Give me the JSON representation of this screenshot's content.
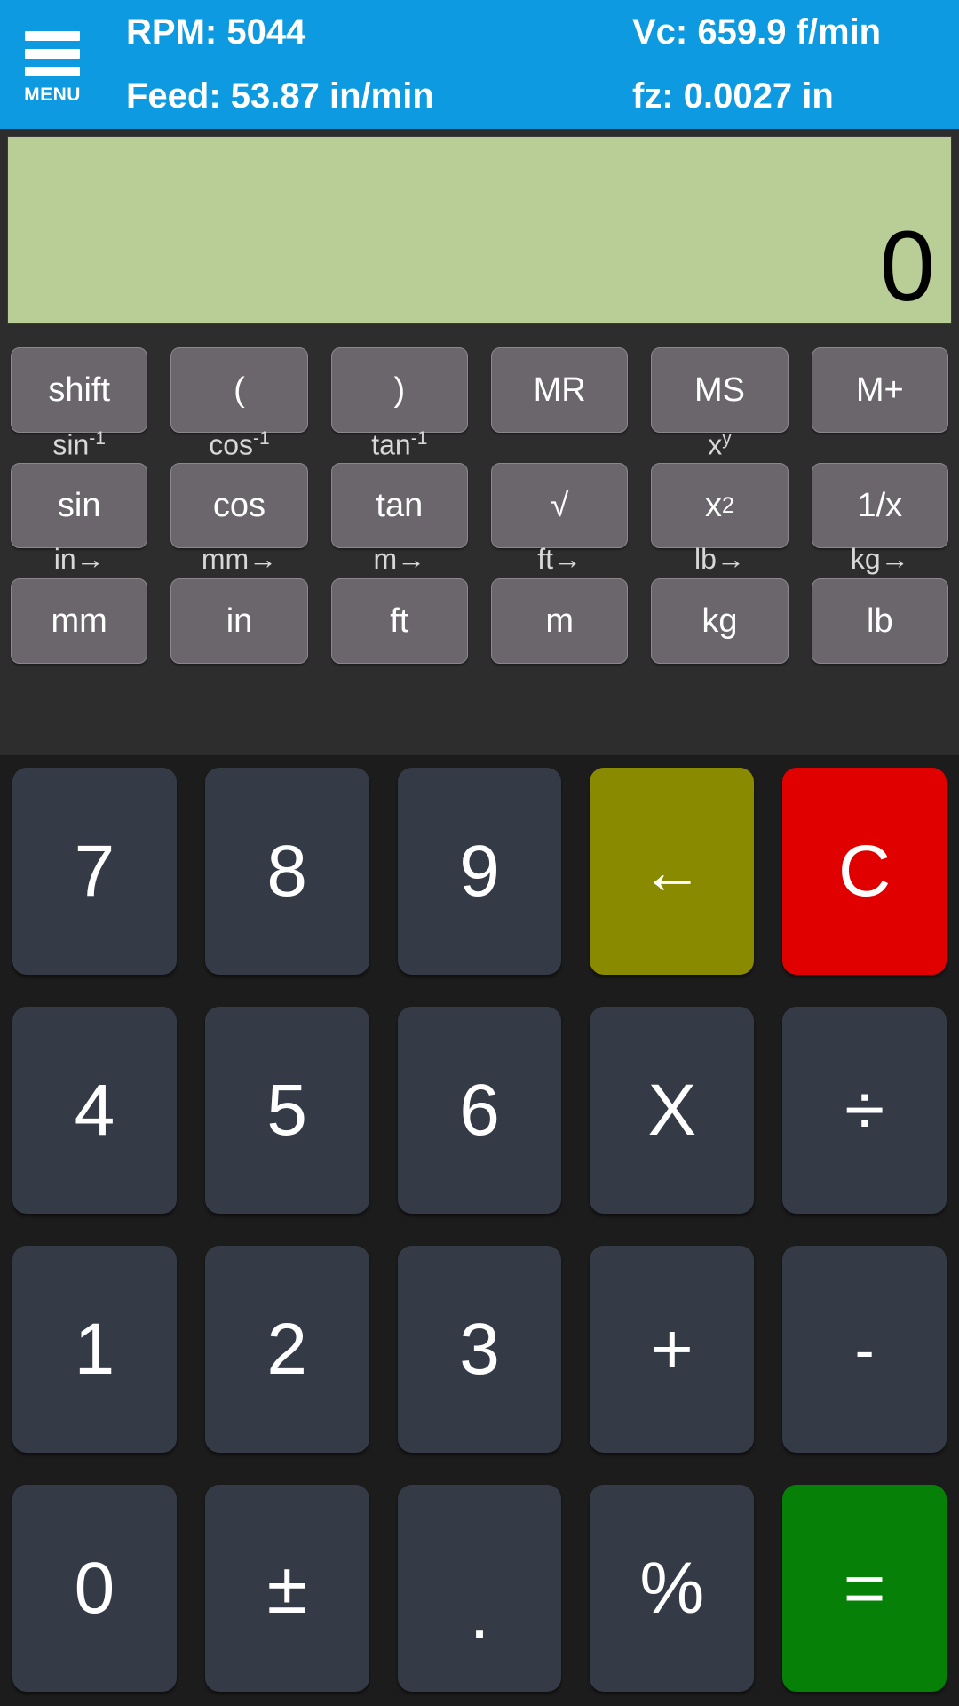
{
  "header": {
    "menu_label": "MENU",
    "menu_icon": "hamburger-menu-icon",
    "readouts": [
      {
        "key": "rpm",
        "text": "RPM: 5044"
      },
      {
        "key": "vc",
        "text": "Vc: 659.9 f/min"
      },
      {
        "key": "feed",
        "text": "Feed: 53.87 in/min"
      },
      {
        "key": "fz",
        "text": "fz: 0.0027 in"
      }
    ],
    "values": {
      "rpm": "5044",
      "vc": "659.9 f/min",
      "feed": "53.87 in/min",
      "fz": "0.0027 in"
    },
    "background_color": "#0d9ae0"
  },
  "display": {
    "value": "0",
    "background_color": "#b9cd96",
    "text_color": "#000000"
  },
  "function_pad": {
    "row1": [
      {
        "label": "shift",
        "shift": ""
      },
      {
        "label": "(",
        "shift": ""
      },
      {
        "label": ")",
        "shift": ""
      },
      {
        "label": "MR",
        "shift": ""
      },
      {
        "label": "MS",
        "shift": ""
      },
      {
        "label": "M+",
        "shift": ""
      }
    ],
    "row2": [
      {
        "label": "sin",
        "shift": "sin-1"
      },
      {
        "label": "cos",
        "shift": "cos-1"
      },
      {
        "label": "tan",
        "shift": "tan-1"
      },
      {
        "label": "√",
        "shift": ""
      },
      {
        "label": "x2",
        "shift": "xy"
      },
      {
        "label": "1/x",
        "shift": ""
      }
    ],
    "row3": [
      {
        "label": "mm",
        "shift": "in→"
      },
      {
        "label": "in",
        "shift": "mm→"
      },
      {
        "label": "ft",
        "shift": "m→"
      },
      {
        "label": "m",
        "shift": "ft→"
      },
      {
        "label": "kg",
        "shift": "lb→"
      },
      {
        "label": "lb",
        "shift": "kg→"
      }
    ],
    "button_color": "#6a666c"
  },
  "keypad": {
    "keys": [
      {
        "label": "7",
        "style": "num"
      },
      {
        "label": "8",
        "style": "num"
      },
      {
        "label": "9",
        "style": "num"
      },
      {
        "label": "←",
        "style": "back"
      },
      {
        "label": "C",
        "style": "clear"
      },
      {
        "label": "4",
        "style": "num"
      },
      {
        "label": "5",
        "style": "num"
      },
      {
        "label": "6",
        "style": "num"
      },
      {
        "label": "X",
        "style": "num"
      },
      {
        "label": "÷",
        "style": "num"
      },
      {
        "label": "1",
        "style": "num"
      },
      {
        "label": "2",
        "style": "num"
      },
      {
        "label": "3",
        "style": "num"
      },
      {
        "label": "+",
        "style": "num"
      },
      {
        "label": "-",
        "style": "minus"
      },
      {
        "label": "0",
        "style": "num"
      },
      {
        "label": "±",
        "style": "num"
      },
      {
        "label": ".",
        "style": "dot"
      },
      {
        "label": "%",
        "style": "num"
      },
      {
        "label": "=",
        "style": "equals"
      }
    ],
    "colors": {
      "number": "#343b47",
      "backspace": "#8a8a00",
      "clear": "#e00000",
      "equals": "#068006"
    }
  }
}
